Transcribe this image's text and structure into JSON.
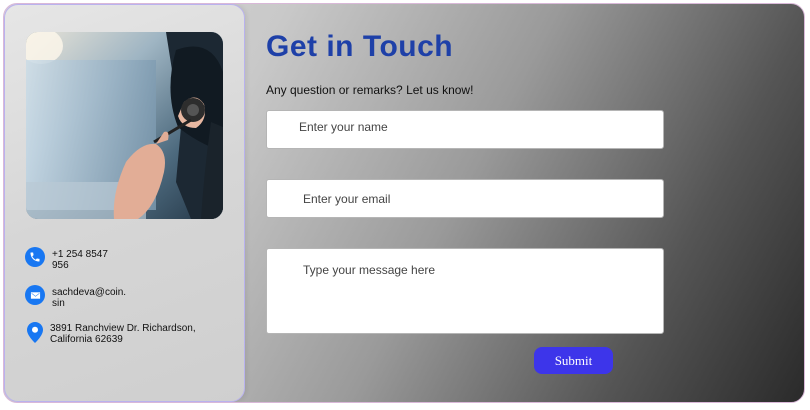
{
  "contact": {
    "phone": "+1 254 8547\n956",
    "email": "sachdeva@coin.\nsin",
    "address": "3891 Ranchview Dr. Richardson,\nCalifornia 62639"
  },
  "form": {
    "title": "Get in Touch",
    "subtitle": "Any question or remarks? Let us know!",
    "name_placeholder": "Enter your name",
    "email_placeholder": "Enter your email",
    "message_placeholder": "Type your message here",
    "submit_label": "Submit"
  },
  "colors": {
    "accent": "#1e40a8",
    "button": "#3d35ea",
    "icon": "#1877f2"
  },
  "icons": {
    "photo": "support-agent-photo",
    "phone": "phone-icon",
    "email": "mail-icon",
    "address": "location-pin-icon"
  }
}
